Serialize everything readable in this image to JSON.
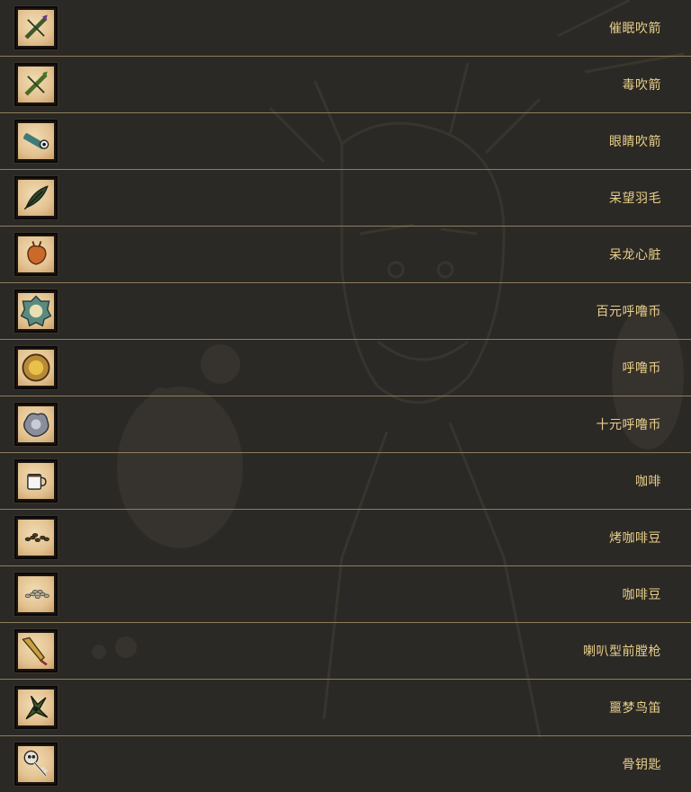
{
  "items": [
    {
      "name": "催眠吹箭",
      "icon": "sleep-dart-icon"
    },
    {
      "name": "毒吹箭",
      "icon": "poison-dart-icon"
    },
    {
      "name": "眼睛吹箭",
      "icon": "eye-dart-icon"
    },
    {
      "name": "呆望羽毛",
      "icon": "gaze-feather-icon"
    },
    {
      "name": "呆龙心脏",
      "icon": "dragon-heart-icon"
    },
    {
      "name": "百元呼噜币",
      "icon": "hundred-oinc-icon"
    },
    {
      "name": "呼噜币",
      "icon": "oinc-icon"
    },
    {
      "name": "十元呼噜币",
      "icon": "ten-oinc-icon"
    },
    {
      "name": "咖啡",
      "icon": "coffee-icon"
    },
    {
      "name": "烤咖啡豆",
      "icon": "roasted-coffee-beans-icon"
    },
    {
      "name": "咖啡豆",
      "icon": "coffee-beans-icon"
    },
    {
      "name": "喇叭型前膛枪",
      "icon": "blunderbuss-icon"
    },
    {
      "name": "噩梦鸟笛",
      "icon": "nightmare-bird-whistle-icon"
    },
    {
      "name": "骨钥匙",
      "icon": "bone-key-icon"
    }
  ],
  "colors": {
    "background": "#2b2925",
    "label": "#e8cf8a",
    "divider": "#8e7d5a",
    "icon_bg": "#e3c291"
  }
}
